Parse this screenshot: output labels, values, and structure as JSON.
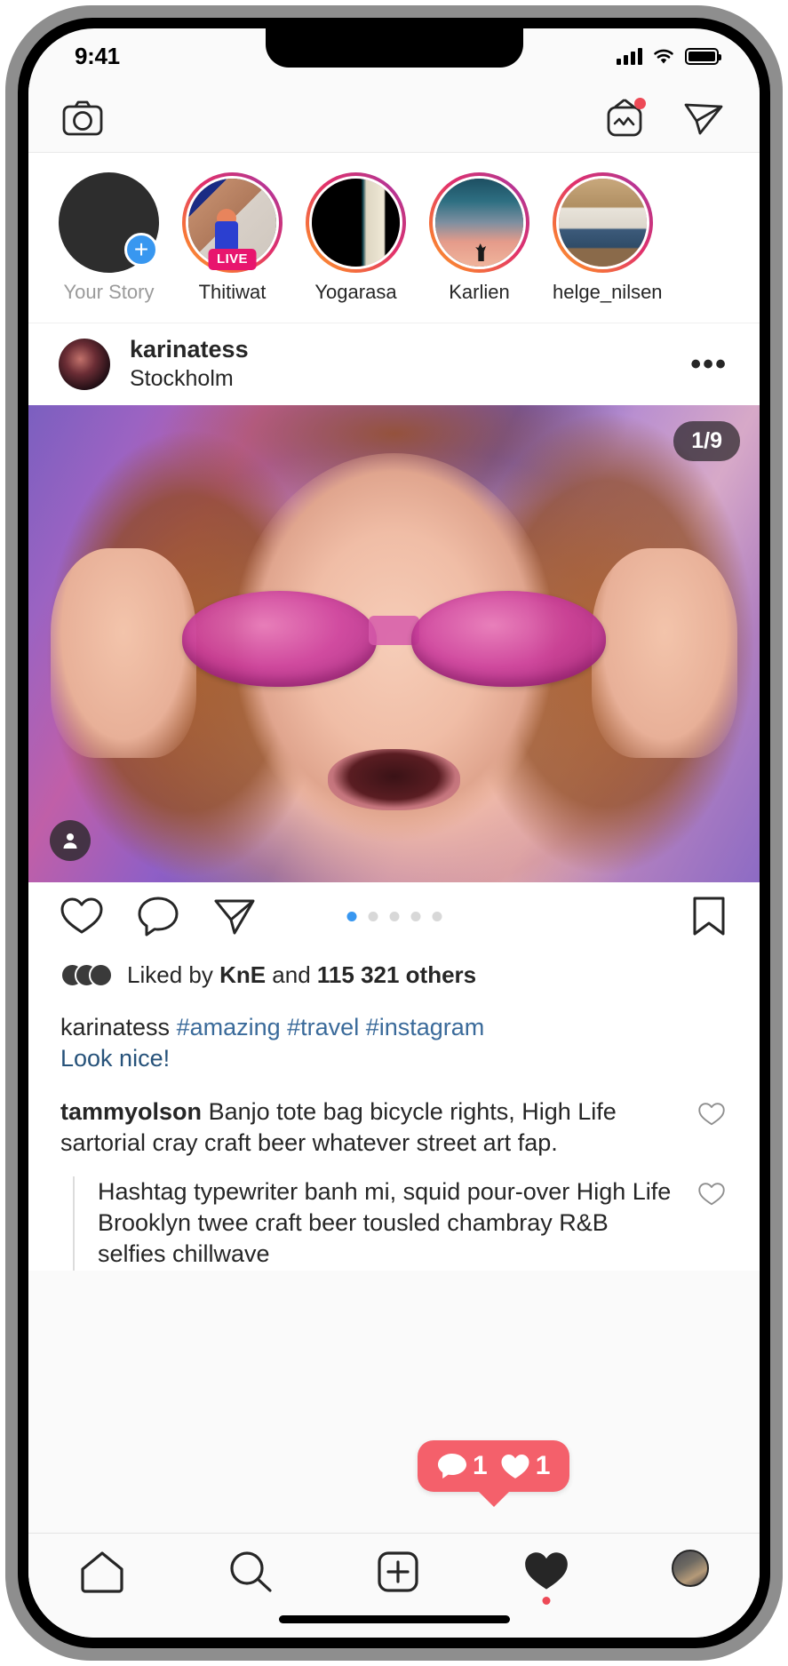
{
  "status_bar": {
    "time": "9:41",
    "signal_icon": "cellular-signal-icon",
    "wifi_icon": "wifi-icon",
    "battery_icon": "battery-full-icon"
  },
  "top_nav": {
    "camera_icon": "camera-icon",
    "igtv_icon": "igtv-icon",
    "igtv_has_badge": true,
    "direct_icon": "direct-share-icon"
  },
  "stories": [
    {
      "label": "Your Story",
      "has_ring": false,
      "is_self": true,
      "has_plus": true,
      "live": false
    },
    {
      "label": "Thitiwat",
      "has_ring": true,
      "is_self": false,
      "has_plus": false,
      "live": true,
      "live_label": "LIVE"
    },
    {
      "label": "Yogarasa",
      "has_ring": true,
      "is_self": false,
      "has_plus": false,
      "live": false
    },
    {
      "label": "Karlien",
      "has_ring": true,
      "is_self": false,
      "has_plus": false,
      "live": false
    },
    {
      "label": "helge_nilsen",
      "has_ring": true,
      "is_self": false,
      "has_plus": false,
      "live": false
    }
  ],
  "post": {
    "username": "karinatess",
    "location": "Stockholm",
    "more_icon": "more-options-icon",
    "carousel_counter": "1/9",
    "carousel_total_dots": 5,
    "carousel_active_index": 0,
    "tag_icon": "tagged-people-icon",
    "actions": {
      "like_icon": "heart-outline-icon",
      "comment_icon": "comment-bubble-icon",
      "share_icon": "share-paperplane-icon",
      "save_icon": "bookmark-outline-icon"
    },
    "likes": {
      "prefix": "Liked by ",
      "highlight_user": "KnE",
      "middle": " and ",
      "count": "115 321 others"
    },
    "caption": {
      "username": "karinatess",
      "hashtags": "#amazing #travel #instagram",
      "note": "Look nice!"
    },
    "comments": [
      {
        "username": "tammyolson",
        "text": "Banjo tote bag bicycle rights, High Life sartorial cray craft beer whatever street art fap.",
        "like_icon": "heart-outline-icon",
        "is_reply": false
      },
      {
        "username": "",
        "text": "Hashtag typewriter banh mi, squid pour-over High Life Brooklyn twee craft beer tousled chambray R&B selfies chillwave",
        "like_icon": "heart-outline-icon",
        "is_reply": true
      }
    ]
  },
  "notification_bubble": {
    "comment_icon": "comment-bubble-filled-icon",
    "comment_count": "1",
    "like_icon": "heart-filled-icon",
    "like_count": "1",
    "color": "#f4606b"
  },
  "bottom_nav": [
    {
      "name": "home",
      "icon": "home-icon",
      "active": false,
      "has_dot": false
    },
    {
      "name": "search",
      "icon": "search-magnifier-icon",
      "active": false,
      "has_dot": false
    },
    {
      "name": "create",
      "icon": "add-plus-box-icon",
      "active": false,
      "has_dot": false
    },
    {
      "name": "activity",
      "icon": "heart-filled-icon",
      "active": true,
      "has_dot": true
    },
    {
      "name": "profile",
      "icon": "profile-avatar-icon",
      "active": false,
      "has_dot": false
    }
  ],
  "colors": {
    "accent_blue": "#3897f0",
    "notification_red": "#ed4956",
    "live_pink": "#e8156e",
    "bubble_red": "#f4606b",
    "link_blue": "#3a6a9a"
  }
}
